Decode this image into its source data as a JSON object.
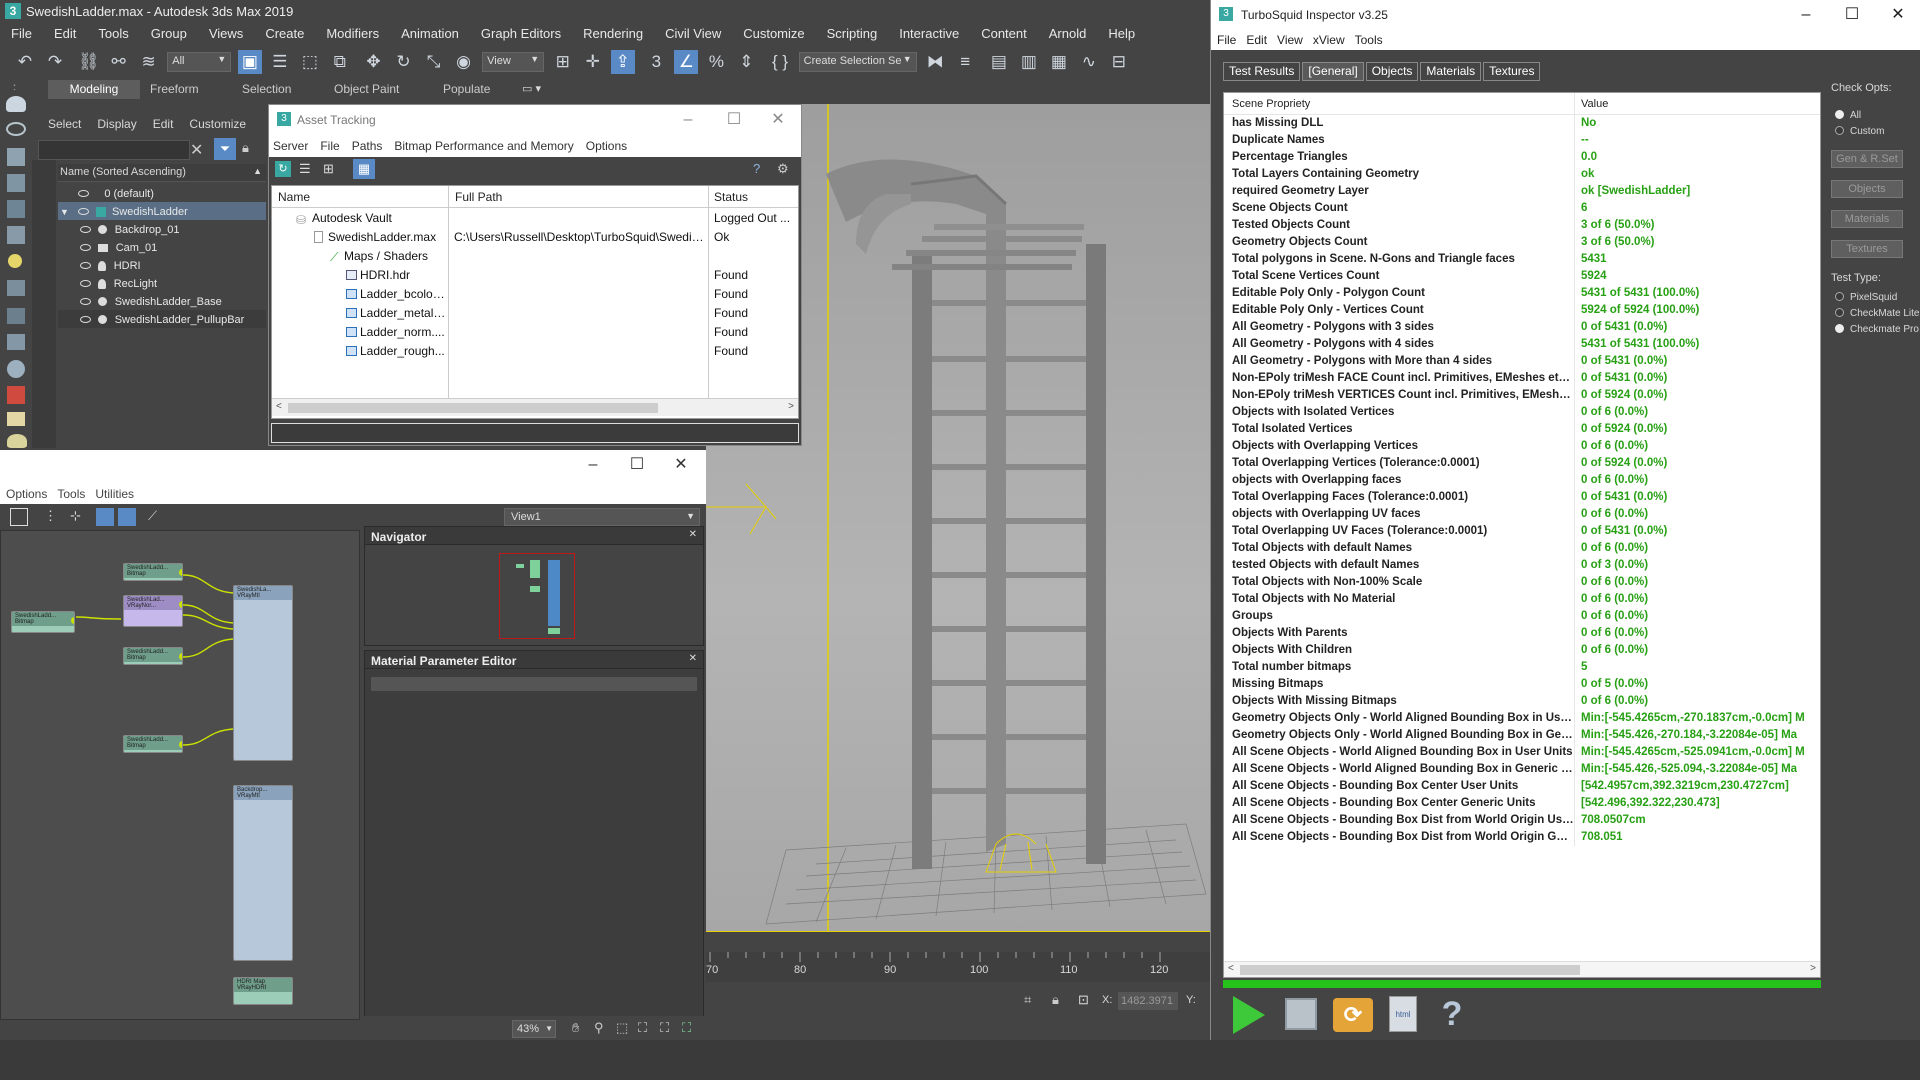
{
  "max": {
    "title": "SwedishLadder.max - Autodesk 3ds Max 2019",
    "menu": [
      "File",
      "Edit",
      "Tools",
      "Group",
      "Views",
      "Create",
      "Modifiers",
      "Animation",
      "Graph Editors",
      "Rendering",
      "Civil View",
      "Customize",
      "Scripting",
      "Interactive",
      "Content",
      "Arnold",
      "Help"
    ],
    "filter_dropdown": "All",
    "view_dropdown": "View",
    "selection_set": "Create Selection Se",
    "ribbon_tabs": [
      "Modeling",
      "Freeform",
      "Selection",
      "Object Paint",
      "Populate"
    ],
    "scene_menu": [
      "Select",
      "Display",
      "Edit",
      "Customize"
    ],
    "scene_header": "Name (Sorted Ascending)",
    "scene_items": [
      "0 (default)",
      "SwedishLadder",
      "Backdrop_01",
      "Cam_01",
      "HDRI",
      "RecLight",
      "SwedishLadder_Base",
      "SwedishLadder_PullupBar"
    ],
    "slate_menu": [
      "Options",
      "Tools",
      "Utilities"
    ],
    "slate_view_dropdown": "View1",
    "navigator_title": "Navigator",
    "mat_param_title": "Material Parameter Editor",
    "zoom_value": "43%",
    "ruler_ticks": [
      "70",
      "80",
      "90",
      "100",
      "110",
      "120"
    ],
    "coord_x_label": "X:",
    "coord_x_value": "1482.3971",
    "coord_y_label": "Y:",
    "nodes": {
      "n1": "SwedishLadd... Bitmap",
      "n2": "SwedishLadd... Bitmap",
      "n3": "SwedishLad... VRayNor...",
      "n4": "SwedishLadd... Bitmap",
      "n5": "SwedishLadd... Bitmap",
      "n6": "SwedishLa... VRayMtl",
      "n7": "Backdrop... VRayMtl",
      "n8": "HDRI Map VRayHDRI"
    }
  },
  "asset_tracking": {
    "title": "Asset Tracking",
    "menu": [
      "Server",
      "File",
      "Paths",
      "Bitmap Performance and Memory",
      "Options"
    ],
    "columns": [
      "Name",
      "Full Path",
      "Status"
    ],
    "rows": [
      {
        "name": "Autodesk Vault",
        "path": "",
        "status": "Logged Out ..."
      },
      {
        "name": "SwedishLadder.max",
        "path": "C:\\Users\\Russell\\Desktop\\TurboSquid\\Swedis...",
        "status": "Ok"
      },
      {
        "name": "Maps / Shaders",
        "path": "",
        "status": ""
      },
      {
        "name": "HDRI.hdr",
        "path": "",
        "status": "Found"
      },
      {
        "name": "Ladder_bcolor...",
        "path": "",
        "status": "Found"
      },
      {
        "name": "Ladder_metal....",
        "path": "",
        "status": "Found"
      },
      {
        "name": "Ladder_norm....",
        "path": "",
        "status": "Found"
      },
      {
        "name": "Ladder_rough...",
        "path": "",
        "status": "Found"
      }
    ]
  },
  "inspector": {
    "title": "TurboSquid Inspector v3.25",
    "menu": [
      "File",
      "Edit",
      "View",
      "xView",
      "Tools"
    ],
    "tabs": [
      "Test Results",
      "[General]",
      "Objects",
      "Materials",
      "Textures"
    ],
    "col_property": "Scene Propriety",
    "col_value": "Value",
    "rows": [
      [
        "has Missing DLL",
        "No"
      ],
      [
        "Duplicate Names",
        "--"
      ],
      [
        "Percentage Triangles",
        "0.0"
      ],
      [
        "Total Layers Containing Geometry",
        "ok"
      ],
      [
        "required Geometry Layer",
        "ok [SwedishLadder]"
      ],
      [
        "Scene Objects Count",
        "6"
      ],
      [
        "Tested Objects Count",
        "3 of 6 (50.0%)"
      ],
      [
        "Geometry Objects Count",
        "3 of 6 (50.0%)"
      ],
      [
        "Total polygons in Scene. N-Gons and Triangle faces",
        "5431"
      ],
      [
        "Total Scene Vertices Count",
        "5924"
      ],
      [
        "Editable Poly Only - Polygon Count",
        "5431 of 5431 (100.0%)"
      ],
      [
        "Editable Poly Only - Vertices Count",
        "5924 of 5924 (100.0%)"
      ],
      [
        "All Geometry - Polygons with 3 sides",
        "0 of 5431 (0.0%)"
      ],
      [
        "All Geometry - Polygons with 4 sides",
        "5431 of 5431 (100.0%)"
      ],
      [
        "All Geometry - Polygons with More than 4 sides",
        "0 of 5431 (0.0%)"
      ],
      [
        "Non-EPoly triMesh FACE Count incl. Primitives, EMeshes etc...",
        "0 of 5431 (0.0%)"
      ],
      [
        "Non-EPoly triMesh VERTICES Count incl. Primitives, EMeshes ...",
        "0 of 5924 (0.0%)"
      ],
      [
        "Objects with Isolated Vertices",
        "0 of 6 (0.0%)"
      ],
      [
        "Total Isolated Vertices",
        "0 of 5924 (0.0%)"
      ],
      [
        "Objects with Overlapping Vertices",
        "0 of 6 (0.0%)"
      ],
      [
        "Total Overlapping Vertices (Tolerance:0.0001)",
        "0 of 5924 (0.0%)"
      ],
      [
        "objects with Overlapping faces",
        "0 of 6 (0.0%)"
      ],
      [
        "Total Overlapping Faces (Tolerance:0.0001)",
        "0 of 5431 (0.0%)"
      ],
      [
        "objects with Overlapping UV faces",
        "0 of 6 (0.0%)"
      ],
      [
        "Total Overlapping UV Faces (Tolerance:0.0001)",
        "0 of 5431 (0.0%)"
      ],
      [
        "Total Objects with default Names",
        "0 of 6 (0.0%)"
      ],
      [
        "tested Objects with default Names",
        "0 of 3 (0.0%)"
      ],
      [
        "Total Objects with Non-100% Scale",
        "0 of 6 (0.0%)"
      ],
      [
        "Total Objects with No Material",
        "0 of 6 (0.0%)"
      ],
      [
        "Groups",
        "0 of 6 (0.0%)"
      ],
      [
        "Objects With Parents",
        "0 of 6 (0.0%)"
      ],
      [
        "Objects With Children",
        "0 of 6 (0.0%)"
      ],
      [
        "Total number bitmaps",
        "5"
      ],
      [
        "Missing Bitmaps",
        "0 of 5 (0.0%)"
      ],
      [
        "Objects With Missing Bitmaps",
        "0 of 6 (0.0%)"
      ],
      [
        "Geometry Objects Only - World Aligned Bounding Box in User...",
        "Min:[-545.4265cm,-270.1837cm,-0.0cm] M"
      ],
      [
        "Geometry Objects Only - World Aligned Bounding Box in Gen...",
        "Min:[-545.426,-270.184,-3.22084e-05] Ma"
      ],
      [
        "All Scene Objects - World Aligned Bounding Box in User Units",
        "Min:[-545.4265cm,-525.0941cm,-0.0cm] M"
      ],
      [
        "All Scene Objects - World Aligned Bounding Box in Generic Un...",
        "Min:[-545.426,-525.094,-3.22084e-05] Ma"
      ],
      [
        "All Scene Objects - Bounding Box Center User Units",
        "[542.4957cm,392.3219cm,230.4727cm]"
      ],
      [
        "All Scene Objects - Bounding Box Center Generic Units",
        "[542.496,392.322,230.473]"
      ],
      [
        "All Scene Objects - Bounding Box Dist from World Origin User...",
        "708.0507cm"
      ],
      [
        "All Scene Objects - Bounding Box Dist from World Origin Gen...",
        "708.051"
      ]
    ],
    "check_opts_label": "Check Opts:",
    "check_opts": [
      "All",
      "Custom"
    ],
    "side_buttons": [
      "Gen & R.Set",
      "Objects",
      "Materials",
      "Textures"
    ],
    "test_type_label": "Test Type:",
    "test_types": [
      "PixelSquid",
      "CheckMate Lite",
      "Checkmate Pro"
    ],
    "progress": 1.0,
    "colors": {
      "value_green": "#27a014",
      "progress_green": "#25c21c"
    }
  }
}
